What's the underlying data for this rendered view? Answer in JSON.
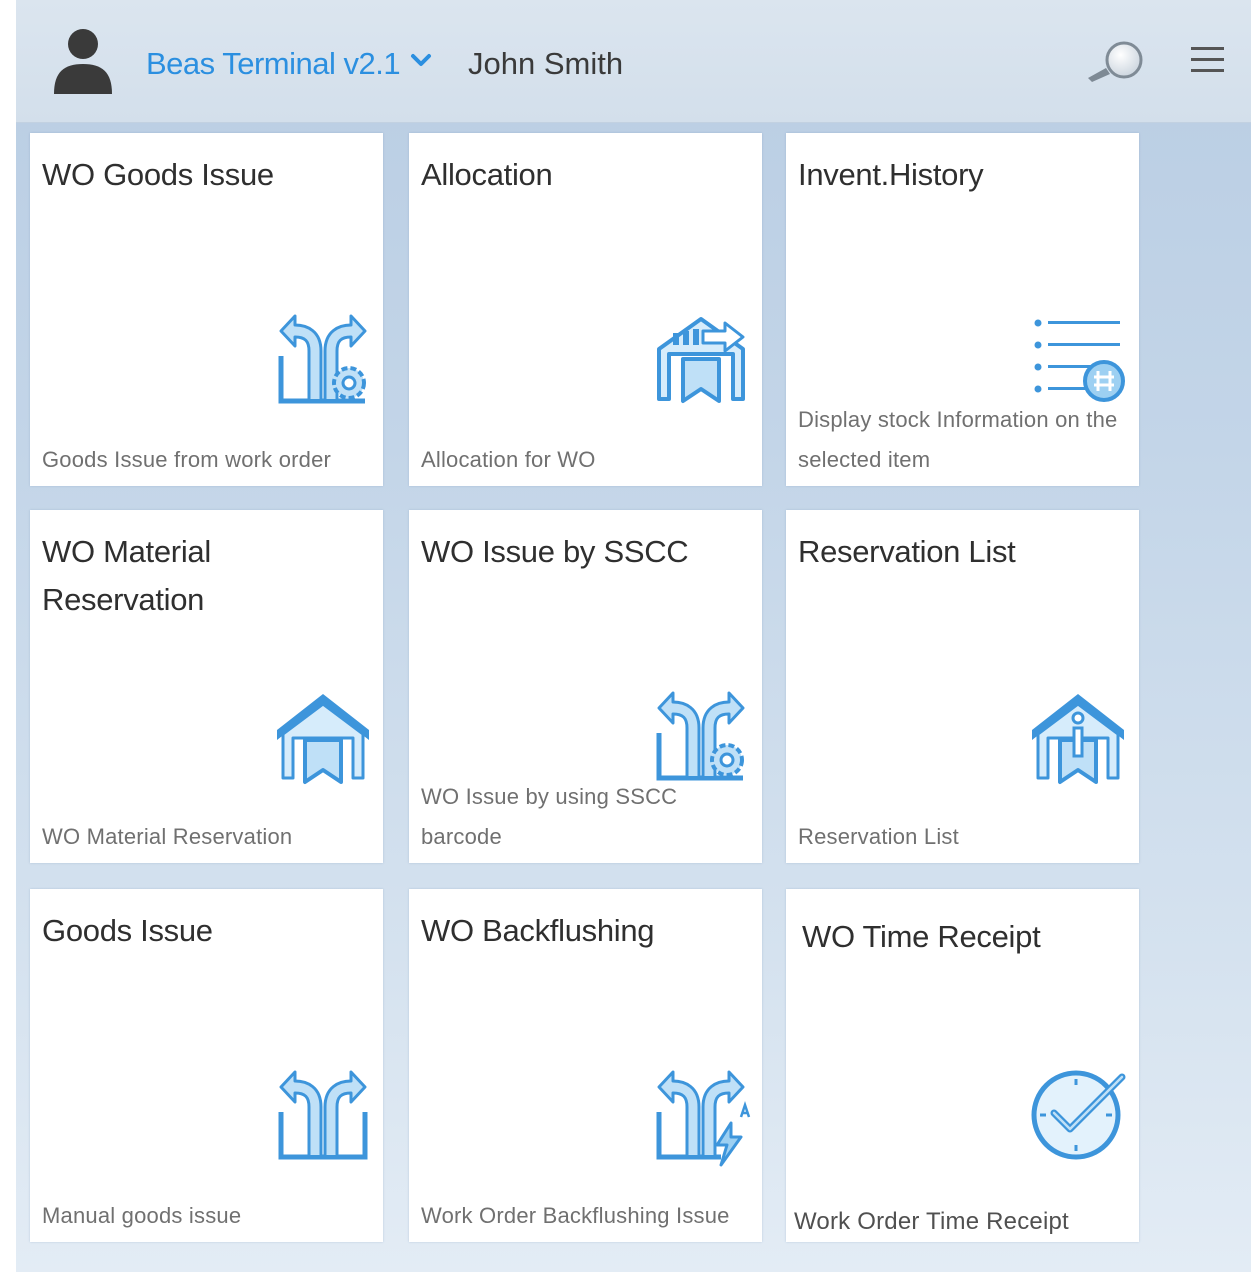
{
  "header": {
    "app_title": "Beas Terminal v2.1",
    "user_name": "John Smith",
    "icons": {
      "avatar": "user-avatar-icon",
      "dropdown": "chevron-down-icon",
      "search": "magnifier-search-icon",
      "menu": "hamburger-menu-icon"
    }
  },
  "tiles": [
    {
      "title": "WO Goods Issue",
      "desc": "Goods Issue from work order",
      "icon": "issue-arrows-gear-icon"
    },
    {
      "title": "Allocation",
      "desc": "Allocation for WO",
      "icon": "allocation-warehouse-icon"
    },
    {
      "title": "Invent.History",
      "desc": "Display stock Information on the selected item",
      "icon": "list-history-icon"
    },
    {
      "title": "WO Material Reservation",
      "desc": "WO Material Reservation",
      "icon": "warehouse-bookmark-icon"
    },
    {
      "title": "WO Issue by SSCC",
      "desc": "WO Issue by using SSCC barcode",
      "icon": "issue-arrows-gear-icon"
    },
    {
      "title": "Reservation List",
      "desc": "Reservation List",
      "icon": "warehouse-info-icon"
    },
    {
      "title": "Goods Issue",
      "desc": "Manual goods issue",
      "icon": "issue-arrows-icon"
    },
    {
      "title": "WO Backflushing",
      "desc": "Work Order Backflushing Issue",
      "icon": "issue-arrows-lightning-icon"
    },
    {
      "title": "WO Time Receipt",
      "desc": "Work Order Time Receipt",
      "icon": "clock-check-icon"
    }
  ],
  "colors": {
    "accent": "#2b8fe0",
    "icon_stroke": "#3d95db",
    "icon_fill": "#bfe0f7"
  }
}
